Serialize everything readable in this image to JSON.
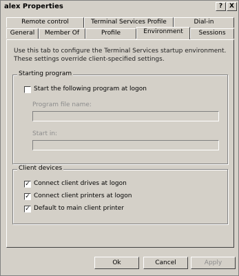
{
  "window": {
    "title": "alex Properties",
    "help_glyph": "?",
    "close_glyph": "X"
  },
  "tabs_back": [
    {
      "label": "Remote control"
    },
    {
      "label": "Terminal Services Profile"
    },
    {
      "label": "Dial-in"
    }
  ],
  "tabs_front": [
    {
      "label": "General"
    },
    {
      "label": "Member Of"
    },
    {
      "label": "Profile"
    },
    {
      "label": "Environment",
      "active": true
    },
    {
      "label": "Sessions"
    }
  ],
  "intro_text": "Use this tab to configure the Terminal Services startup environment. These settings override client-specified settings.",
  "starting_program": {
    "legend": "Starting program",
    "checkbox_label": "Start the following program at logon",
    "checked": false,
    "program_file_label": "Program file name:",
    "program_file_value": "",
    "start_in_label": "Start in:",
    "start_in_value": ""
  },
  "client_devices": {
    "legend": "Client devices",
    "items": [
      {
        "label": "Connect client drives at logon",
        "checked": true
      },
      {
        "label": "Connect client printers at logon",
        "checked": true
      },
      {
        "label": "Default to main client printer",
        "checked": true
      }
    ]
  },
  "buttons": {
    "ok": "Ok",
    "cancel": "Cancel",
    "apply": "Apply"
  },
  "check_glyph": "✓"
}
